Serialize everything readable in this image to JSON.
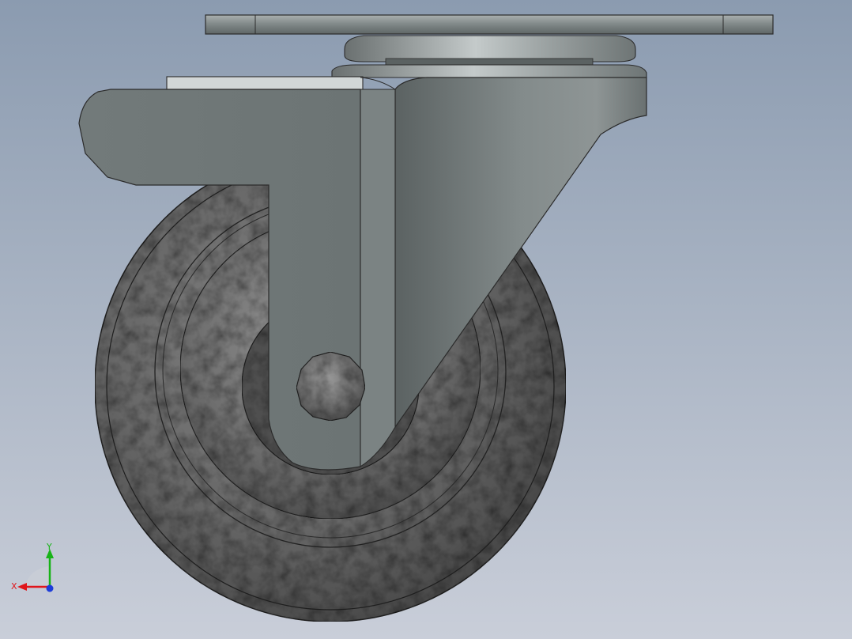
{
  "triad": {
    "x_label": "X",
    "y_label": "Y",
    "x_axis_color": "#e0161b",
    "y_axis_color": "#17b317",
    "z_axis_color": "#1c3cd9"
  },
  "colors": {
    "background_top": "#8b9bb0",
    "background_bottom": "#c9ced9",
    "bracket_gray": "#737b7b",
    "wheel_dark": "#4a4a4a"
  }
}
